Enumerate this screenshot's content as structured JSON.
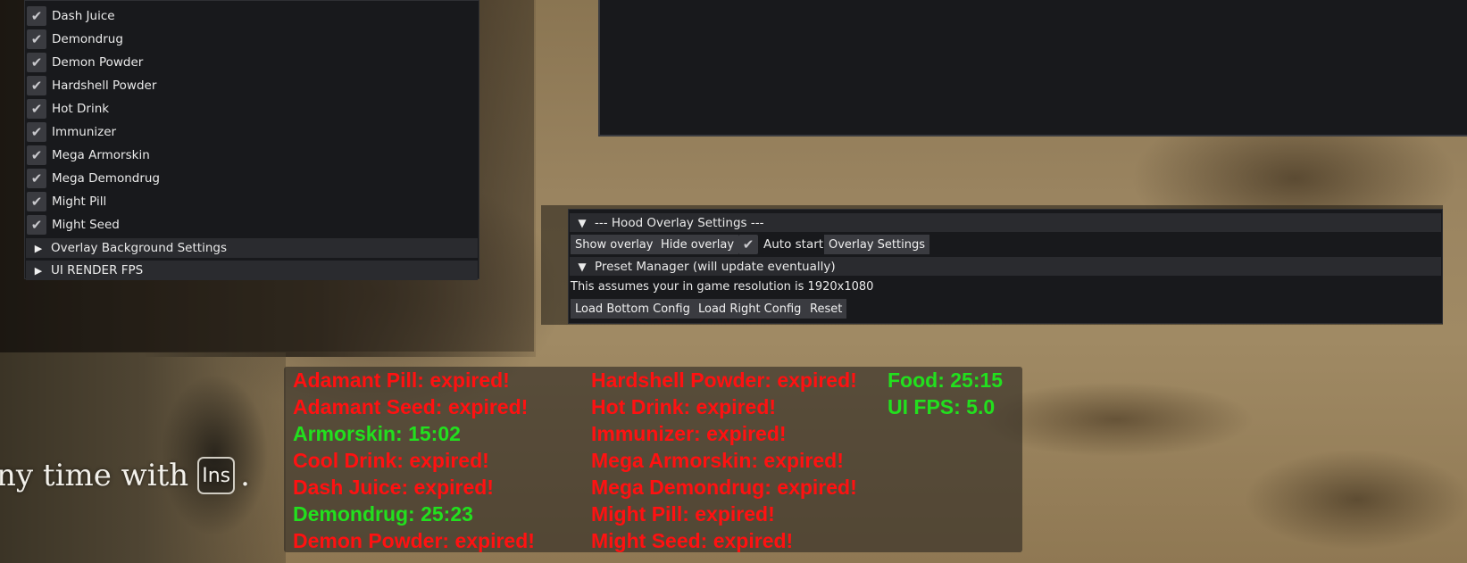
{
  "colors": {
    "panel_bg": "#18191c",
    "header_bg": "#2a2b2f",
    "button_bg": "#3a3b40",
    "hud_red": "#ff1111",
    "hud_green": "#22e01e"
  },
  "buff_list": {
    "items": [
      {
        "label": "Dash Juice",
        "checked": true,
        "icon": "check-icon"
      },
      {
        "label": "Demondrug",
        "checked": true,
        "icon": "check-icon"
      },
      {
        "label": "Demon Powder",
        "checked": true,
        "icon": "check-icon"
      },
      {
        "label": "Hardshell Powder",
        "checked": true,
        "icon": "check-icon"
      },
      {
        "label": "Hot Drink",
        "checked": true,
        "icon": "check-icon"
      },
      {
        "label": "Immunizer",
        "checked": true,
        "icon": "check-icon"
      },
      {
        "label": "Mega Armorskin",
        "checked": true,
        "icon": "check-icon"
      },
      {
        "label": "Mega Demondrug",
        "checked": true,
        "icon": "check-icon"
      },
      {
        "label": "Might Pill",
        "checked": true,
        "icon": "check-icon"
      },
      {
        "label": "Might Seed",
        "checked": true,
        "icon": "check-icon"
      }
    ],
    "sections": [
      {
        "label": "Overlay Background Settings",
        "icon": "triangle-right-icon"
      },
      {
        "label": "UI RENDER FPS",
        "icon": "triangle-right-icon"
      }
    ]
  },
  "overlay_settings": {
    "header": "--- Hood Overlay Settings ---",
    "show_overlay": "Show overlay",
    "hide_overlay": "Hide overlay",
    "auto_start": {
      "label": "Auto start",
      "checked": true
    },
    "overlay_settings_btn": "Overlay Settings",
    "preset_header": "Preset Manager (will update eventually)",
    "resolution_note": "This assumes your in game resolution is 1920x1080",
    "load_bottom": "Load Bottom Config",
    "load_right": "Load Right Config",
    "reset": "Reset"
  },
  "hud": {
    "col1": [
      {
        "text": "Adamant Pill: expired!",
        "status": "expired"
      },
      {
        "text": "Adamant Seed: expired!",
        "status": "expired"
      },
      {
        "text": "Armorskin: 15:02",
        "status": "active"
      },
      {
        "text": "Cool Drink: expired!",
        "status": "expired"
      },
      {
        "text": "Dash Juice: expired!",
        "status": "expired"
      },
      {
        "text": "Demondrug: 25:23",
        "status": "active"
      },
      {
        "text": "Demon Powder: expired!",
        "status": "expired"
      }
    ],
    "col2": [
      {
        "text": "Hardshell Powder: expired!",
        "status": "expired"
      },
      {
        "text": "Hot Drink: expired!",
        "status": "expired"
      },
      {
        "text": "Immunizer: expired!",
        "status": "expired"
      },
      {
        "text": "Mega Armorskin: expired!",
        "status": "expired"
      },
      {
        "text": "Mega Demondrug: expired!",
        "status": "expired"
      },
      {
        "text": "Might Pill: expired!",
        "status": "expired"
      },
      {
        "text": "Might Seed: expired!",
        "status": "expired"
      }
    ],
    "col3": [
      {
        "text": "Food: 25:15",
        "status": "active"
      },
      {
        "text": "UI FPS: 5.0",
        "status": "active"
      }
    ]
  },
  "game_hint": {
    "text": "ny time with",
    "key": "Ins",
    "suffix": "."
  }
}
